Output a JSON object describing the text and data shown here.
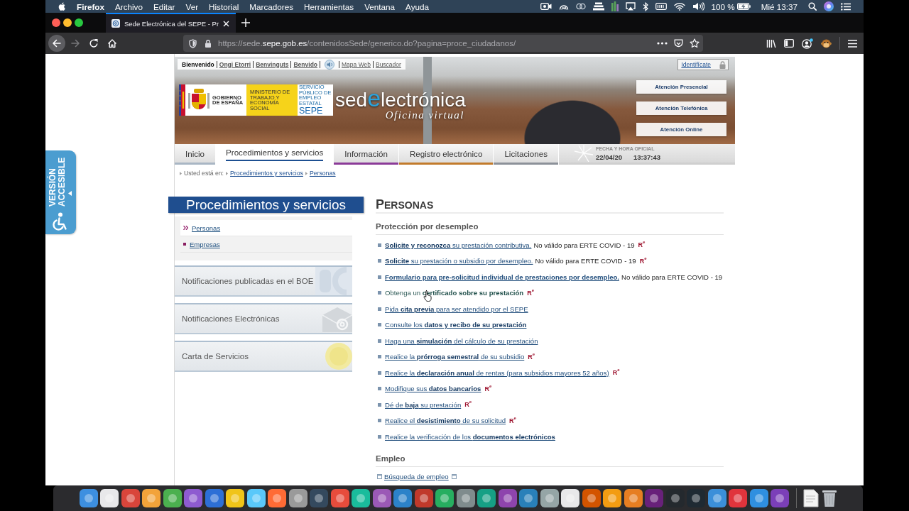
{
  "menu_bar": {
    "app": "Firefox",
    "menus": [
      "Archivo",
      "Editar",
      "Ver",
      "Historial",
      "Marcadores",
      "Herramientas",
      "Ventana",
      "Ayuda"
    ],
    "battery": "100 %",
    "clock": "Mié 13:37"
  },
  "browser": {
    "tabs": [
      {
        "title": "Sede Electrónica del SEPE - Pr",
        "selected": true
      }
    ],
    "nav_buttons": [
      {
        "kind": "back",
        "disabled": false,
        "hovered": true
      },
      {
        "kind": "forward",
        "disabled": true,
        "hovered": false
      },
      {
        "kind": "reload",
        "disabled": false,
        "hovered": false
      },
      {
        "kind": "home",
        "disabled": false,
        "hovered": false
      }
    ],
    "url": {
      "prefix": "https://sede.",
      "domain": "sepe.gob.es",
      "path": "/contenidosSede/generico.do?pagina=proce_ciudadanos/"
    }
  },
  "accessibility_tab": {
    "label": "VERSIÓN ACCESIBLE"
  },
  "header": {
    "languages": [
      {
        "label": "Bienvenido",
        "selected": true
      },
      {
        "label": "Ongi Etorri",
        "selected": false
      },
      {
        "label": "Benvinguts",
        "selected": false
      },
      {
        "label": "Benvido",
        "selected": false
      }
    ],
    "links": [
      "Mapa Web",
      "Buscador"
    ],
    "login": "Identifícate",
    "logo": {
      "government": "GOBIERNO DE ESPAÑA",
      "ministry": "MINISTERIO DE TRABAJO Y ECONOMÍA SOCIAL",
      "agency_full": "SERVICIO PÚBLICO DE EMPLEO ESTATAL",
      "agency": "SEPE"
    },
    "brand": {
      "start": "sed",
      "highlight": "e",
      "end": "lectrónica"
    },
    "tagline": "Oficina virtual",
    "services": [
      "Atención Presencial",
      "Atención Telefónica",
      "Atención Online"
    ]
  },
  "nav": {
    "tabs": [
      {
        "label": "Inicio",
        "selected": false,
        "color": "#a9b6c4"
      },
      {
        "label": "Procedimientos y servicios",
        "selected": true,
        "color": "#1d4f91"
      },
      {
        "label": "Información",
        "selected": false,
        "color": "#8b3b98"
      },
      {
        "label": "Registro electrónico",
        "selected": false,
        "color": "#c27b2c"
      },
      {
        "label": "Licitaciones",
        "selected": false,
        "color": "#8c9199"
      }
    ],
    "clock": {
      "label": "FECHA Y HORA OFICIAL",
      "date": "22/04/20",
      "time": "13:37:43"
    }
  },
  "breadcrumb": {
    "label": "Usted está en:",
    "links": [
      "Procedimientos y servicios",
      "Personas"
    ]
  },
  "sidebar": {
    "title": "Procedimientos y servicios",
    "items": [
      {
        "label": "Personas",
        "selected": true
      },
      {
        "label": "Empresas",
        "selected": false
      }
    ],
    "panels": [
      {
        "kind": "boe",
        "label": "Notificaciones publicadas en el BOE"
      },
      {
        "kind": "email",
        "label": "Notificaciones Electrónicas"
      },
      {
        "kind": "seal",
        "label": "Carta de Servicios"
      }
    ]
  },
  "content": {
    "title": "PERSONAS",
    "sections": [
      {
        "title": "Protección por desempleo",
        "items": [
          {
            "kind": "procedure",
            "link": "**Solicite y reconozca** su prestación contributiva.",
            "bold": false,
            "hovered": false,
            "note": "No válido para ERTE COVID - 19",
            "badge": "R$^{e}$"
          },
          {
            "kind": "procedure",
            "link": "**Solicite** su prestación o subsidio por desempleo.",
            "bold": false,
            "hovered": false,
            "note": "No válido para ERTE COVID - 19",
            "badge": "R$^{e}$"
          },
          {
            "kind": "procedure",
            "link": "Formulario para pre-solicitud individual de prestaciones por desempleo.",
            "bold": true,
            "hovered": false,
            "note": "No válido para ERTE COVID - 19"
          },
          {
            "kind": "procedure",
            "link": "Obtenga un **certificado sobre su prestación**",
            "bold": false,
            "hovered": true,
            "badge": "R$^{e}$"
          },
          {
            "kind": "procedure",
            "link": "Pida **cita previa** para ser atendido por el SEPE",
            "bold": false,
            "hovered": false
          },
          {
            "kind": "procedure",
            "link": "Consulte los **datos y recibo de su prestación**",
            "bold": false,
            "hovered": false
          },
          {
            "kind": "procedure",
            "link": "Haga una **simulación** del cálculo de su prestación",
            "bold": false,
            "hovered": false
          },
          {
            "kind": "procedure",
            "link": "Realice la **prórroga semestral** de su subsidio",
            "bold": false,
            "hovered": false,
            "badge": "R$^{e}$"
          },
          {
            "kind": "procedure",
            "link": "Realice la **declaración anual** de rentas (para subsidios mayores 52 años)",
            "bold": false,
            "hovered": false,
            "badge": "R$^{e}$"
          },
          {
            "kind": "procedure",
            "link": "Modifique sus **datos bancarios**",
            "bold": false,
            "hovered": false,
            "badge": "R$^{e}$"
          },
          {
            "kind": "procedure",
            "link": "Dé de **baja** su prestación",
            "bold": false,
            "hovered": false,
            "badge": "R$^{e}$"
          },
          {
            "kind": "procedure",
            "link": "Realice el **desistimiento** de su solicitud",
            "bold": false,
            "hovered": false,
            "badge": "R$^{e}$"
          },
          {
            "kind": "procedure",
            "link": "Realice la verificación de los **documentos electrónicos**",
            "bold": false,
            "hovered": false
          }
        ]
      },
      {
        "title": "Empleo",
        "items": [
          {
            "kind": "external",
            "link": "Búsqueda de empleo",
            "bold": false,
            "hovered": false
          }
        ]
      }
    ]
  }
}
